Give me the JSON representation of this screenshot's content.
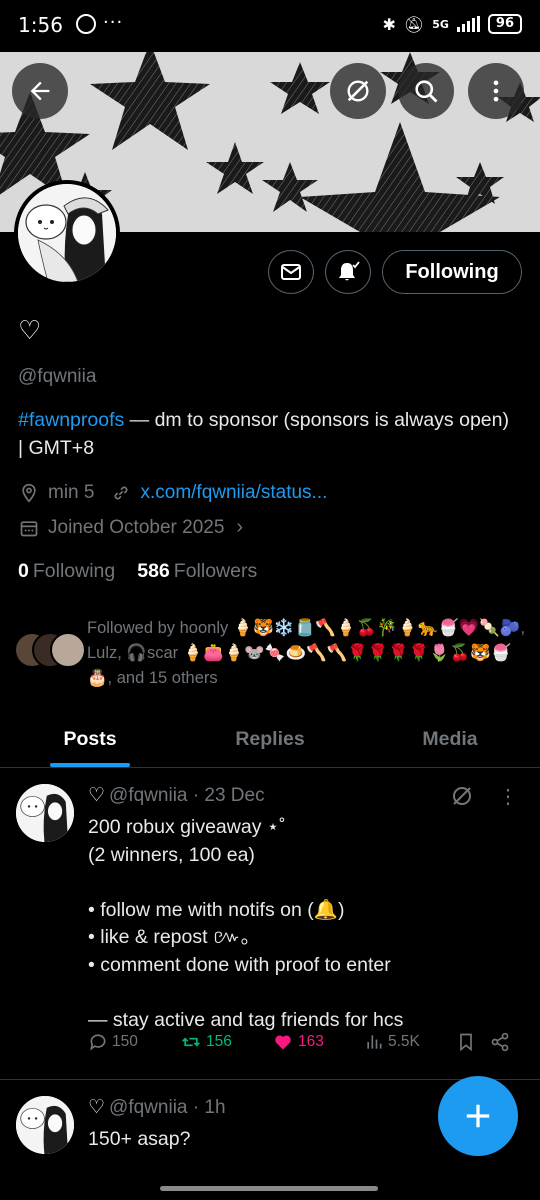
{
  "status_bar": {
    "time": "1:56",
    "battery": "96",
    "network": "5G"
  },
  "profile": {
    "display_name": "♡",
    "handle": "@fqwniia",
    "bio_tag": "#fawnproofs",
    "bio_rest": " — dm to sponsor (sponsors is always open) | GMT+8",
    "location": "min 5",
    "link": "x.com/fqwniia/status...",
    "joined": "Joined October 2025",
    "following_count": "0",
    "following_label": "Following",
    "followers_count": "586",
    "followers_label": "Followers",
    "follow_button": "Following",
    "followed_by": "Followed by hoonly 🍦🐯❄️🫙🪓🍦🍒🎋🍦🐆🍧💗🍡🫐, Lulz, 🎧scar 🍦👛🍦🐭🍬🍮🪓🪓🌹🌹🌹🌹🌷🍒🐯🍧🎂, and 15 others"
  },
  "tabs": [
    {
      "label": "Posts",
      "active": true
    },
    {
      "label": "Replies",
      "active": false
    },
    {
      "label": "Media",
      "active": false
    }
  ],
  "posts": [
    {
      "author_heart": "♡",
      "handle": "@fqwniia",
      "time": "23 Dec",
      "text": "200 robux giveaway ⋆˚\n(2 winners, 100 ea)\n\n• follow me with notifs on (🔔)\n• like & repost ៚。\n• comment done with proof to enter\n\n— stay active and tag friends for hcs",
      "replies": "150",
      "reposts": "156",
      "likes": "163",
      "views": "5.5K"
    },
    {
      "author_heart": "♡",
      "handle": "@fqwniia",
      "time": "1h",
      "text": "150+ asap?"
    }
  ],
  "colors": {
    "accent": "#1d9bf0",
    "repost": "#00ba7c",
    "like": "#f91880",
    "muted": "#71767b"
  }
}
